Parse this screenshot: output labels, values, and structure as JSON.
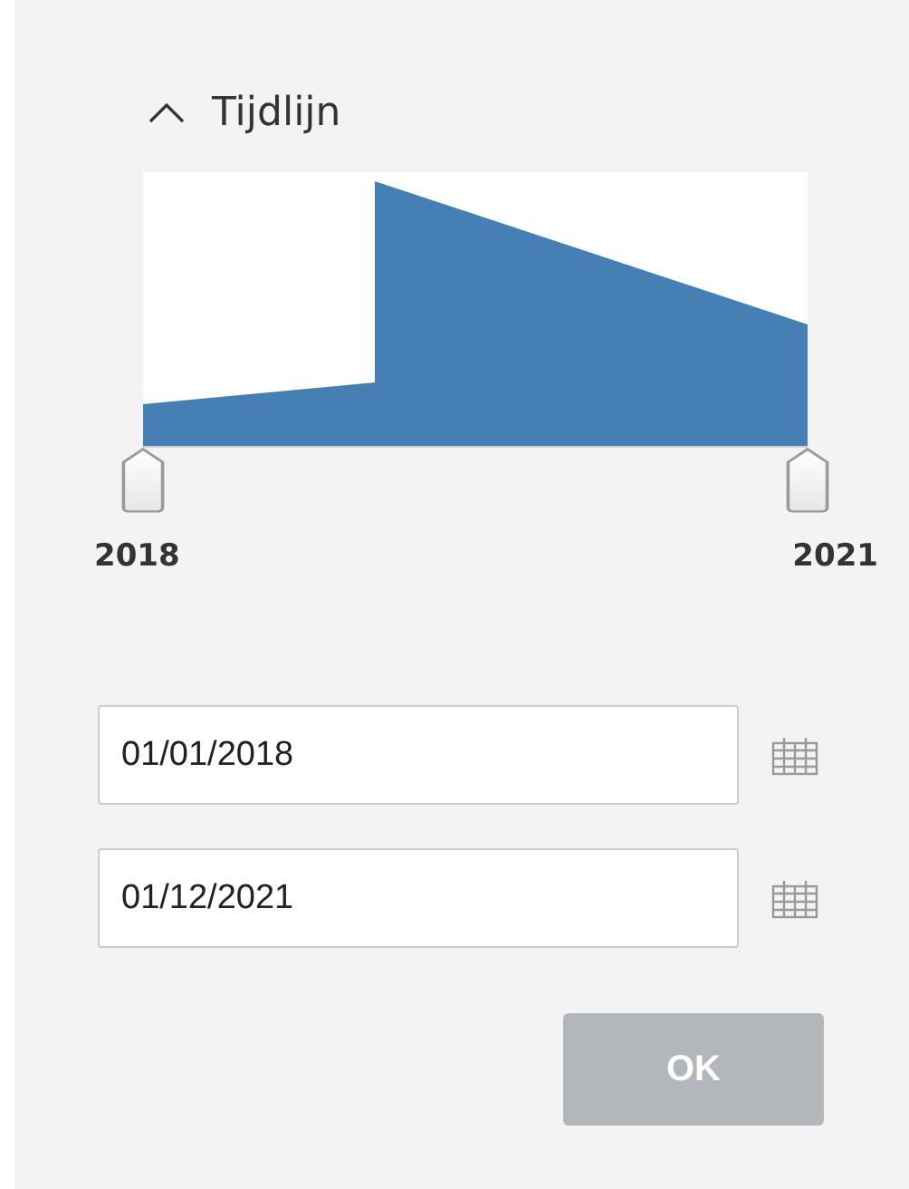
{
  "section": {
    "title": "Tijdlijn",
    "expanded": true
  },
  "timeline": {
    "handles": [
      {
        "level": 0
      },
      {
        "level": 1
      }
    ],
    "labels": [
      "2018",
      "2021"
    ]
  },
  "date_fields": [
    {
      "value": "01/01/2018"
    },
    {
      "value": "01/12/2021"
    }
  ],
  "ok_button": {
    "label": "OK",
    "disabled": true
  }
}
